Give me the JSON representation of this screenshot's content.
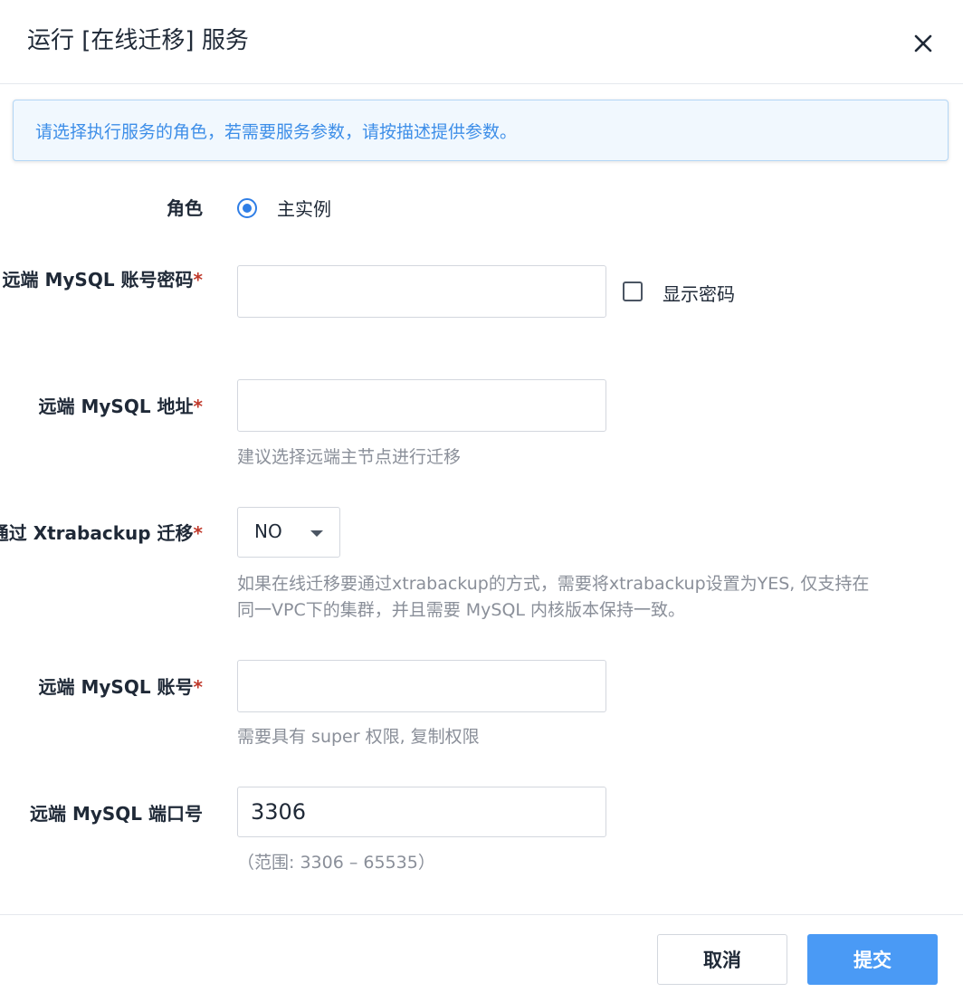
{
  "dialog": {
    "title": "运行 [在线迁移] 服务",
    "notice": "请选择执行服务的角色，若需要服务参数，请按描述提供参数。"
  },
  "form": {
    "role": {
      "label": "角色",
      "option": "主实例",
      "selected": true
    },
    "password": {
      "label": "远端 MySQL 账号密码",
      "required_mark": "*",
      "value": "",
      "show_password_label": "显示密码",
      "show_password_checked": false
    },
    "address": {
      "label": "远端 MySQL 地址",
      "required_mark": "*",
      "value": "",
      "hint": "建议选择远端主节点进行迁移"
    },
    "xtrabackup": {
      "label": "通过 Xtrabackup 迁移",
      "required_mark": "*",
      "value": "NO",
      "hint_line1": "如果在线迁移要通过xtrabackup的方式，需要将xtrabackup设置为YES, 仅支持在",
      "hint_line2": "同一VPC下的集群，并且需要 MySQL 内核版本保持一致。"
    },
    "account": {
      "label": "远端 MySQL 账号",
      "required_mark": "*",
      "value": "",
      "hint": "需要具有 super 权限, 复制权限"
    },
    "port": {
      "label": "远端 MySQL 端口号",
      "value": "3306",
      "hint": "（范围: 3306 – 65535）"
    }
  },
  "footer": {
    "cancel_label": "取消",
    "submit_label": "提交"
  },
  "colors": {
    "accent": "#2f7ee6",
    "submit_bg": "#4a9af5",
    "notice_text": "#3d8ee8",
    "required": "#c0392b"
  },
  "icons": {
    "close": "close-icon",
    "select": "chevron-down-icon"
  }
}
